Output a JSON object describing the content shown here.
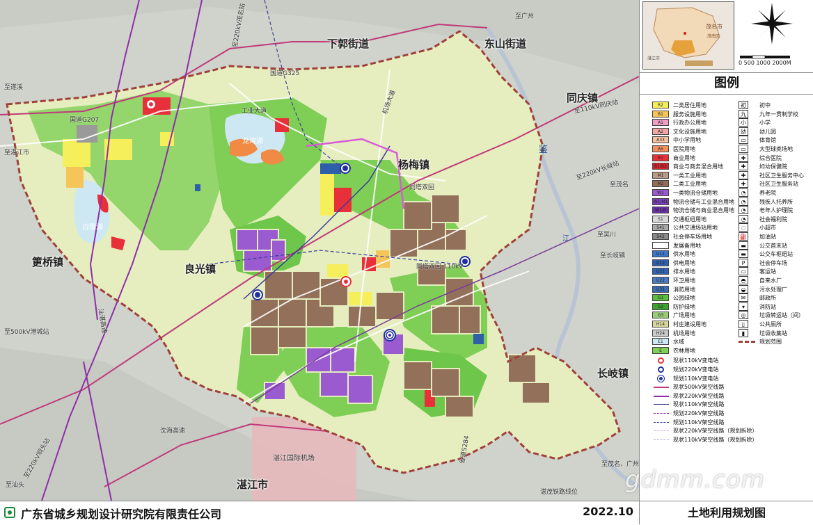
{
  "map": {
    "towns": [
      "下郭街道",
      "东山街道",
      "同庆镇",
      "杨梅镇",
      "良光镇",
      "筻桥镇",
      "长岐镇",
      "湛江市"
    ],
    "roads": [
      "国道G207",
      "国道G325",
      "工业大道",
      "机场大道",
      "沈海高速",
      "汕湛高速",
      "湛江国际机场",
      "湛茂铁路线位",
      "省道S284",
      "同塔双回",
      "至湛江市",
      "至遂溪",
      "至汕头",
      "至茂名",
      "至茂名、广州",
      "至广州",
      "至吴川",
      "至500kV港城站",
      "至220kV垌头站",
      "至220kV茂名站",
      "至220kV长岐站",
      "至110kV同庆站",
      "至长岐镇",
      "同塔双回 110kV"
    ],
    "lakes": [
      "龙湾湖",
      "白鹭湖"
    ],
    "water_label": "江",
    "river_label": "鉴"
  },
  "footer": {
    "org": "广东省城乡规划设计研究院有限责任公司",
    "date": "2022.10"
  },
  "locator": {
    "city": "茂名市",
    "sub": "茂南区",
    "neighbor": "湛江市"
  },
  "scale": {
    "label": "0  500  1000     2000M"
  },
  "legend": {
    "title": "图例",
    "left": [
      {
        "code": "R2",
        "label": "二类居住用地",
        "color": "#f6ef5c"
      },
      {
        "code": "B1",
        "label": "服务设施用地",
        "color": "#f6c55a"
      },
      {
        "code": "A1",
        "label": "行政办公用地",
        "color": "#f19ec4"
      },
      {
        "code": "A2",
        "label": "文化设施用地",
        "color": "#f3a6a6"
      },
      {
        "code": "A33",
        "label": "中小学用地",
        "color": "#f7c2a0"
      },
      {
        "code": "A5",
        "label": "医院用地",
        "color": "#f18f5f"
      },
      {
        "code": "B1",
        "label": "商业用地",
        "color": "#e8303a"
      },
      {
        "code": "B1/B2",
        "label": "商业与商务混合用地",
        "color": "#d9242e"
      },
      {
        "code": "M1",
        "label": "一类工业用地",
        "color": "#b89b86"
      },
      {
        "code": "M2",
        "label": "二类工业用地",
        "color": "#93705a"
      },
      {
        "code": "W1",
        "label": "一类物流仓储用地",
        "color": "#9a5ad0"
      },
      {
        "code": "W1/M1",
        "label": "物流仓储与工业混合用地",
        "color": "#7d42be"
      },
      {
        "code": "W1/B",
        "label": "物流仓储与商业混合用地",
        "color": "#6a32a8"
      },
      {
        "code": "S1",
        "label": "交通枢纽用地",
        "color": "#d9d9d9"
      },
      {
        "code": "S41",
        "label": "公共交通场站用地",
        "color": "#a8a8a8"
      },
      {
        "code": "S42",
        "label": "社会停车场用地",
        "color": "#8a8a8a"
      },
      {
        "code": "",
        "label": "发展备用地",
        "color": "#ffffff"
      },
      {
        "code": "U11",
        "label": "供水用地",
        "color": "#3c75c9"
      },
      {
        "code": "U12",
        "label": "供电用地",
        "color": "#2f5fa8"
      },
      {
        "code": "U21",
        "label": "排水用地",
        "color": "#3165b0"
      },
      {
        "code": "U22",
        "label": "环卫用地",
        "color": "#4a7dc0"
      },
      {
        "code": "U31",
        "label": "消防用地",
        "color": "#3a6db5"
      },
      {
        "code": "G1",
        "label": "公园绿地",
        "color": "#5cbd3e"
      },
      {
        "code": "G2",
        "label": "防护绿地",
        "color": "#3fa332"
      },
      {
        "code": "G3",
        "label": "广场用地",
        "color": "#9acb7a"
      },
      {
        "code": "H14",
        "label": "村庄建设用地",
        "color": "#d8d89c"
      },
      {
        "code": "H24",
        "label": "机场用地",
        "color": "#c9c9c9"
      },
      {
        "code": "E1",
        "label": "水域",
        "color": "#cde8f3"
      },
      {
        "code": "E",
        "label": "农林用地",
        "color": "#7fce56"
      }
    ],
    "points": [
      {
        "label": "现状110kV变电站",
        "style": "red"
      },
      {
        "label": "规划220kV变电站",
        "style": "blue2"
      },
      {
        "label": "规划110kV变电站",
        "style": "blue"
      }
    ],
    "lines": [
      {
        "label": "现状500kV架空线路",
        "color": "#c0397a",
        "dash": "none",
        "w": 2
      },
      {
        "label": "现状220kV架空线路",
        "color": "#8e2ea8",
        "dash": "none",
        "w": 2
      },
      {
        "label": "现状110kV架空线路",
        "color": "#3a3a9a",
        "dash": "none",
        "w": 1.5
      },
      {
        "label": "规划220kV架空线路",
        "color": "#8e2ea8",
        "dash": "5,3",
        "w": 1.5
      },
      {
        "label": "规划110kV架空线路",
        "color": "#3a3a9a",
        "dash": "5,3",
        "w": 1.5
      },
      {
        "label": "现状220kV架空线路（规划拆除）",
        "color": "#d6a0d8",
        "dash": "5,3",
        "w": 1.5
      },
      {
        "label": "现状110kV架空线路（规划拆除）",
        "color": "#a6a6e0",
        "dash": "5,3",
        "w": 1.5
      }
    ],
    "right": [
      {
        "glyph": "初",
        "label": "初中"
      },
      {
        "glyph": "九",
        "label": "九年一贯制学校"
      },
      {
        "glyph": "小",
        "label": "小学"
      },
      {
        "glyph": "幼",
        "label": "幼儿园"
      },
      {
        "glyph": "▭",
        "label": "体育馆"
      },
      {
        "glyph": "▭",
        "label": "大型球类场地"
      },
      {
        "glyph": "✚",
        "label": "综合医院"
      },
      {
        "glyph": "✚",
        "label": "妇幼保健院"
      },
      {
        "glyph": "✚",
        "label": "社区卫生服务中心"
      },
      {
        "glyph": "✚",
        "label": "社区卫生服务站"
      },
      {
        "glyph": "◔",
        "label": "养老院"
      },
      {
        "glyph": "◔",
        "label": "残疾人托养所"
      },
      {
        "glyph": "◔",
        "label": "老年人护理院"
      },
      {
        "glyph": "◔",
        "label": "社会福利院"
      },
      {
        "glyph": "◌",
        "label": "小超市"
      },
      {
        "glyph": "⛽",
        "label": "加油站"
      },
      {
        "glyph": "▬",
        "label": "公交首末站"
      },
      {
        "glyph": "▬",
        "label": "公交车枢纽站"
      },
      {
        "glyph": "P",
        "label": "社会停车场"
      },
      {
        "glyph": "▭",
        "label": "客运站"
      },
      {
        "glyph": "◓",
        "label": "自来水厂"
      },
      {
        "glyph": "◒",
        "label": "污水处理厂"
      },
      {
        "glyph": "✉",
        "label": "邮政所"
      },
      {
        "glyph": "▾",
        "label": "消防站"
      },
      {
        "glyph": "◎",
        "label": "垃圾转运站（间）"
      },
      {
        "glyph": "▯",
        "label": "公共厕所"
      },
      {
        "glyph": "▮",
        "label": "垃圾收集站"
      },
      {
        "glyph": "--",
        "label": "规划范围"
      }
    ]
  },
  "map_title": "土地利用规划图",
  "watermark": "gdmm.com"
}
